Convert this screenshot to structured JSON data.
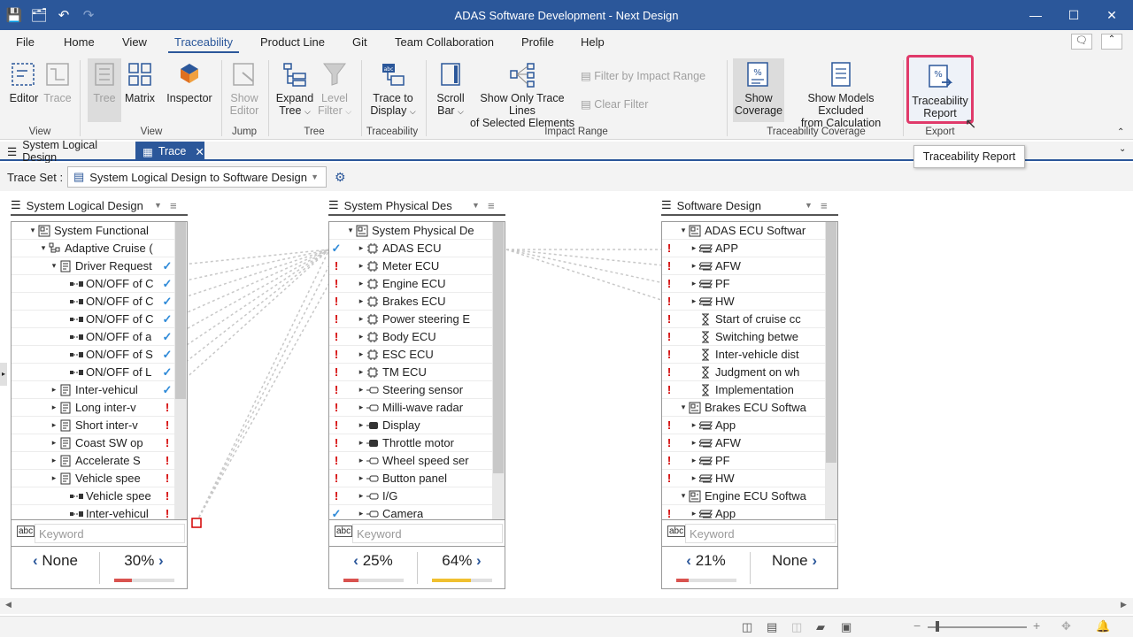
{
  "window": {
    "title": "ADAS Software Development - Next Design"
  },
  "menu": [
    "File",
    "Home",
    "View",
    "Traceability",
    "Product Line",
    "Git",
    "Team Collaboration",
    "Profile",
    "Help"
  ],
  "ribbon": {
    "editor": "Editor",
    "trace": "Trace",
    "group_view": "View",
    "tree": "Tree",
    "matrix": "Matrix",
    "inspector": "Inspector",
    "group_view2": "View",
    "show_editor": [
      "Show",
      "Editor"
    ],
    "group_jump": "Jump",
    "expand_tree": [
      "Expand",
      "Tree"
    ],
    "level_filter": [
      "Level",
      "Filter"
    ],
    "group_tree": "Tree",
    "trace_to_display": [
      "Trace to",
      "Display"
    ],
    "group_traceability": "Traceability",
    "scroll_bar": [
      "Scroll",
      "Bar"
    ],
    "show_only": [
      "Show Only Trace Lines",
      "of Selected Elements"
    ],
    "filter_impact": "Filter by Impact Range",
    "clear_filter": "Clear Filter",
    "group_impact": "Impact Range",
    "show_coverage": [
      "Show",
      "Coverage"
    ],
    "show_excluded": [
      "Show Models Excluded",
      "from Calculation"
    ],
    "group_coverage": "Traceability Coverage",
    "trace_report": [
      "Traceability",
      "Report"
    ],
    "group_export": "Export"
  },
  "tooltip": "Traceability Report",
  "doc_tabs": [
    "System Logical Design",
    "Trace"
  ],
  "trace_set": {
    "label": "Trace Set :",
    "value": "System Logical Design to Software Design"
  },
  "keyword_placeholder": "Keyword",
  "columns": [
    {
      "title": "System Logical Design",
      "rows": [
        {
          "t": "System Functional",
          "m": ""
        },
        {
          "t": "Adaptive Cruise (",
          "m": ""
        },
        {
          "t": "Driver Request",
          "m": "ok"
        },
        {
          "t": "ON/OFF of C",
          "m": "ok"
        },
        {
          "t": "ON/OFF of C",
          "m": "ok"
        },
        {
          "t": "ON/OFF of C",
          "m": "ok"
        },
        {
          "t": "ON/OFF of  a",
          "m": "ok"
        },
        {
          "t": "ON/OFF of S",
          "m": "ok"
        },
        {
          "t": "ON/OFF of L",
          "m": "ok"
        },
        {
          "t": "Inter-vehicul",
          "m": "ok"
        },
        {
          "t": "Long inter-v",
          "m": "err"
        },
        {
          "t": "Short inter-v",
          "m": "err"
        },
        {
          "t": "Coast SW op",
          "m": "err"
        },
        {
          "t": "Accelerate S",
          "m": "err"
        },
        {
          "t": "Vehicle spee",
          "m": "err"
        },
        {
          "t": "Vehicle spee",
          "m": "err"
        },
        {
          "t": "Inter-vehicul",
          "m": "err"
        }
      ],
      "coverage": {
        "left": "None",
        "right": "30%",
        "right_value": 0.3
      }
    },
    {
      "title": "System Physical Des",
      "rows": [
        {
          "t": "System Physical De",
          "m": ""
        },
        {
          "t": "ADAS ECU",
          "m": "ok"
        },
        {
          "t": "Meter ECU",
          "m": "err"
        },
        {
          "t": "Engine ECU",
          "m": "err"
        },
        {
          "t": "Brakes ECU",
          "m": "err"
        },
        {
          "t": "Power steering E",
          "m": "err"
        },
        {
          "t": "Body ECU",
          "m": "err"
        },
        {
          "t": "ESC ECU",
          "m": "err"
        },
        {
          "t": "TM ECU",
          "m": "err"
        },
        {
          "t": "Steering sensor",
          "m": "err"
        },
        {
          "t": "Milli-wave radar",
          "m": "err"
        },
        {
          "t": "Display",
          "m": "err"
        },
        {
          "t": "Throttle motor",
          "m": "err"
        },
        {
          "t": "Wheel speed ser",
          "m": "err"
        },
        {
          "t": "Button panel",
          "m": "err"
        },
        {
          "t": "I/G",
          "m": "err"
        },
        {
          "t": "Camera",
          "m": "ok"
        }
      ],
      "coverage": {
        "left": "25%",
        "left_value": 0.25,
        "right": "64%",
        "right_value": 0.64
      }
    },
    {
      "title": "Software Design",
      "rows": [
        {
          "t": "ADAS ECU Softwar",
          "m": ""
        },
        {
          "t": "APP",
          "m": "err"
        },
        {
          "t": "AFW",
          "m": "err"
        },
        {
          "t": "PF",
          "m": "err"
        },
        {
          "t": "HW",
          "m": "err"
        },
        {
          "t": "Start of cruise cc",
          "m": "err"
        },
        {
          "t": "Switching betwe",
          "m": "err"
        },
        {
          "t": "Inter-vehicle dist",
          "m": "err"
        },
        {
          "t": "Judgment on wh",
          "m": "err"
        },
        {
          "t": "Implementation",
          "m": "err"
        },
        {
          "t": "Brakes ECU Softwa",
          "m": ""
        },
        {
          "t": "App",
          "m": "err"
        },
        {
          "t": "AFW",
          "m": "err"
        },
        {
          "t": "PF",
          "m": "err"
        },
        {
          "t": "HW",
          "m": "err"
        },
        {
          "t": "Engine ECU Softwa",
          "m": ""
        },
        {
          "t": "App",
          "m": "err"
        }
      ],
      "coverage": {
        "left": "21%",
        "left_value": 0.21,
        "right": "None"
      }
    }
  ],
  "colors": {
    "accent": "#2b579a",
    "error": "#d40000",
    "ok": "#2e8ad8",
    "bar_red": "#d9534f",
    "bar_yellow": "#f0c030",
    "highlight": "#e03a6a"
  }
}
